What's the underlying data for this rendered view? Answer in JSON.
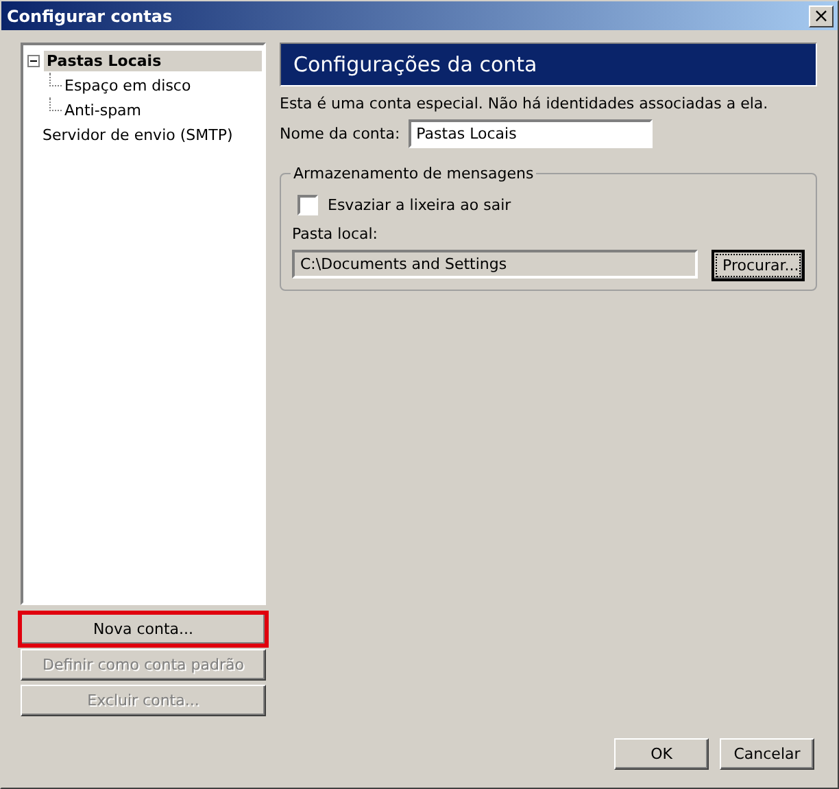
{
  "window": {
    "title": "Configurar contas",
    "close": "×"
  },
  "tree": [
    {
      "label": "Pastas Locais",
      "selected": true,
      "expanded": true,
      "children": [
        {
          "label": "Espaço em disco",
          "selected": false
        },
        {
          "label": "Anti-spam",
          "selected": false
        }
      ]
    },
    {
      "label": "Servidor de envio (SMTP)",
      "selected": false
    }
  ],
  "left_buttons": [
    {
      "label": "Nova conta...",
      "disabled": false,
      "highlighted": true
    },
    {
      "label": "Definir como conta padrão",
      "disabled": true,
      "highlighted": false
    },
    {
      "label": "Excluir conta...",
      "disabled": true,
      "highlighted": false
    }
  ],
  "panel": {
    "heading": "Configurações da conta",
    "info": "Esta é uma conta especial. Não há identidades associadas a ela.",
    "account_name": {
      "label": "Nome da conta:",
      "value": "Pastas Locais"
    },
    "group": {
      "legend": "Armazenamento de mensagens",
      "checkbox": {
        "label": "Esvaziar a lixeira ao sair",
        "checked": false
      },
      "folder": {
        "label": "Pasta local:",
        "value": "C:\\Documents and Settings"
      },
      "browse": "Procurar..."
    }
  },
  "buttons": [
    "OK",
    "Cancelar"
  ]
}
